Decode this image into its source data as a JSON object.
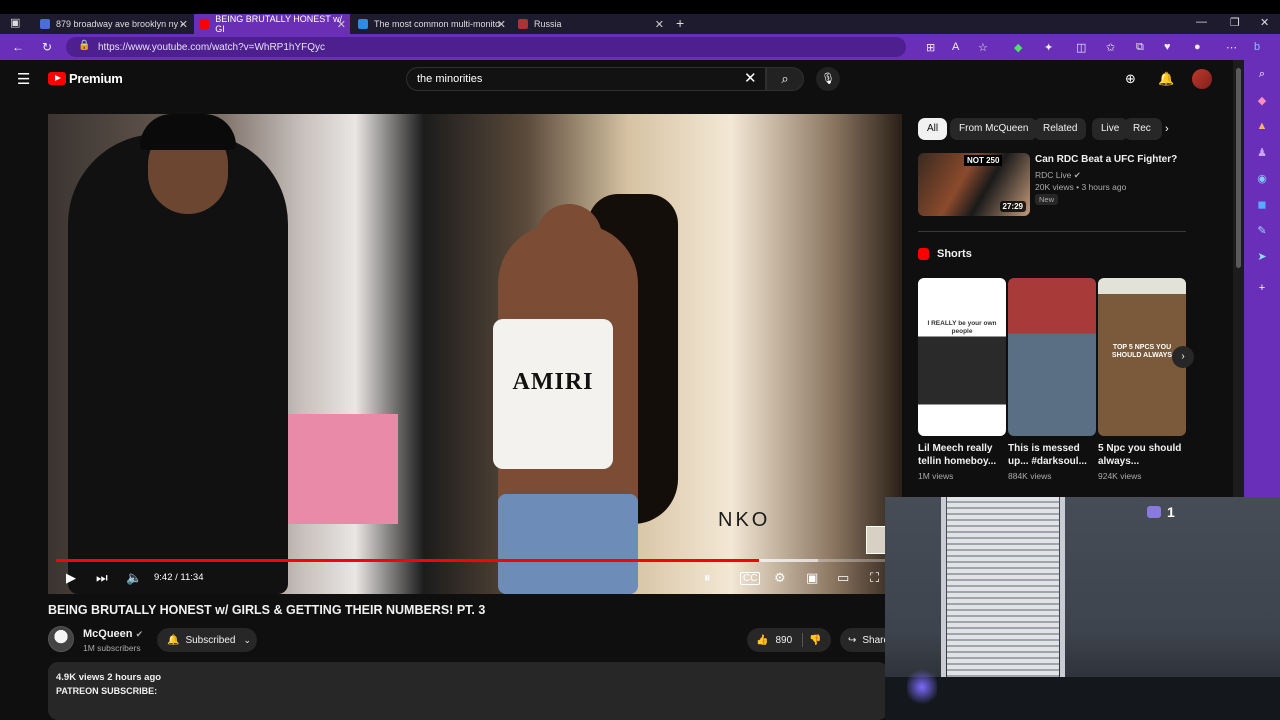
{
  "browser": {
    "tabs": [
      {
        "label": "879 broadway ave brooklyn ny -",
        "active": false
      },
      {
        "label": "BEING BRUTALLY HONEST w/ GI",
        "active": true
      },
      {
        "label": "The most common multi-monito",
        "active": false
      },
      {
        "label": "Russia",
        "active": false
      }
    ],
    "new_tab": "+",
    "url": "https://www.youtube.com/watch?v=WhRP1hYFQyc"
  },
  "youtube": {
    "logo": "Premium",
    "search_value": "the minorities",
    "player": {
      "time": "9:42 / 11:34",
      "progress": 0.839,
      "shirt_text": "AMIRI",
      "store_sign": "NKO"
    },
    "video": {
      "title": "BEING BRUTALLY HONEST w/ GIRLS & GETTING THEIR NUMBERS! PT. 3",
      "channel": "McQueen",
      "subscribers": "1M subscribers",
      "subscribe_label": "Subscribed",
      "likes": "890",
      "share_label": "Share",
      "views_time": "4.9K views  2 hours ago",
      "desc_line": "PATREON SUBSCRIBE:"
    },
    "chips": [
      "All",
      "From McQueen",
      "Related",
      "Live",
      "Rec"
    ],
    "recommended": {
      "title": "Can RDC Beat a UFC Fighter?",
      "channel": "RDC Live",
      "meta": "20K views  •  3 hours ago",
      "badge": "New",
      "thumb_text": "NOT 250",
      "duration": "27:29"
    },
    "shorts_heading": "Shorts",
    "shorts": [
      {
        "title": "Lil Meech really tellin homeboy...",
        "views": "1M views",
        "caption": "I REALLY be your own people"
      },
      {
        "title": "This is messed up... #darksoul...",
        "views": "884K views",
        "caption": ""
      },
      {
        "title": "5 Npc you should always...",
        "views": "924K views",
        "caption": "TOP 5 NPCS YOU SHOULD ALWAYS"
      }
    ]
  },
  "webcam": {
    "count": "1"
  },
  "colors": {
    "browser_accent": "#6a2fb8",
    "yt_red": "#ff0000",
    "yt_bg": "#0f0f0f"
  }
}
